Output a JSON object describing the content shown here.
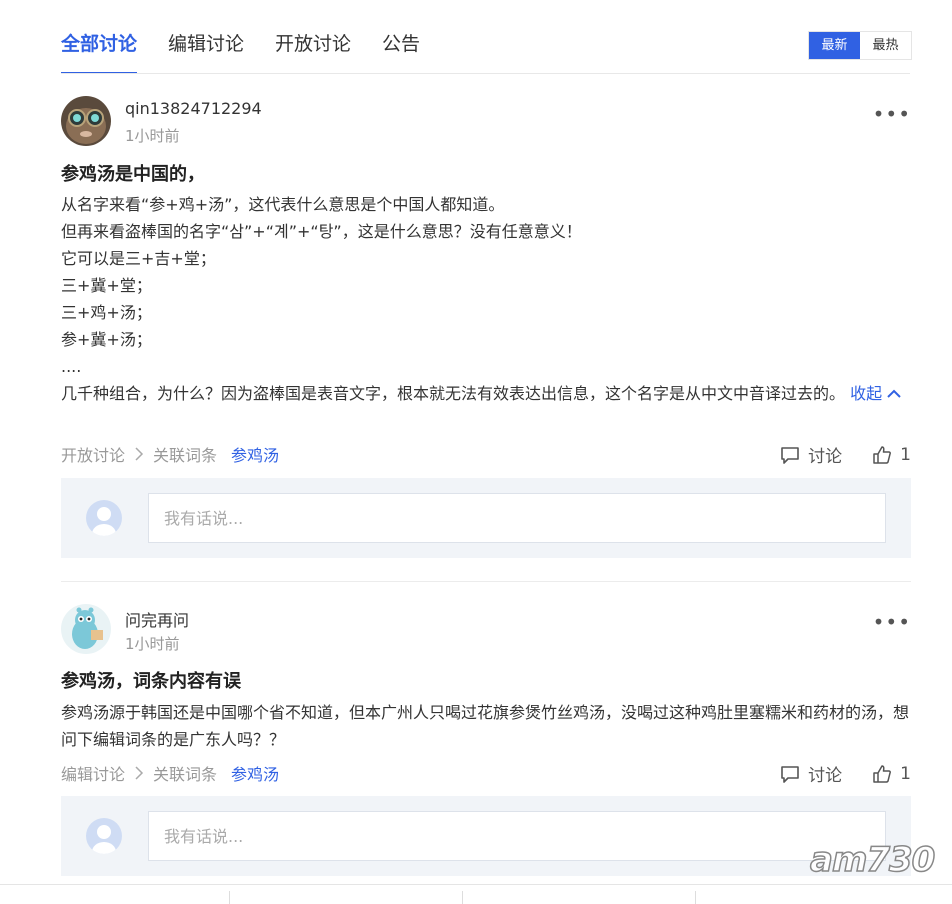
{
  "tabs": [
    {
      "label": "全部讨论",
      "active": true
    },
    {
      "label": "编辑讨论",
      "active": false
    },
    {
      "label": "开放讨论",
      "active": false
    },
    {
      "label": "公告",
      "active": false
    }
  ],
  "sort": {
    "latest": "最新",
    "hot": "最热"
  },
  "posts": [
    {
      "username": "qin13824712294",
      "time": "1小时前",
      "title": "参鸡汤是中国的，",
      "lines": [
        "从名字来看“参+鸡+汤”，这代表什么意思是个中国人都知道。",
        "但再来看盗棒国的名字“삼”+“계”+“탕”，这是什么意思？没有任意意义！",
        "它可以是三+吉+堂；",
        "三+冀+堂；",
        "三+鸡+汤；",
        "参+冀+汤；",
        "....",
        "几千种组合，为什么？因为盗棒国是表音文字，根本就无法有效表达出信息，这个名字是从中文中音译过去的。"
      ],
      "collapse": "收起",
      "category": "开放讨论",
      "related": "关联词条",
      "tag": "参鸡汤",
      "discuss": "讨论",
      "likes": "1",
      "reply_placeholder": "我有话说..."
    },
    {
      "username": "问完再问",
      "time": "1小时前",
      "title": "参鸡汤，词条内容有误",
      "lines": [
        "参鸡汤源于韩国还是中国哪个省不知道，但本广州人只喝过花旗参煲竹丝鸡汤，没喝过这种鸡肚里塞糯米和药材的汤，想问下编辑词条的是广东人吗？？"
      ],
      "category": "编辑讨论",
      "related": "关联词条",
      "tag": "参鸡汤",
      "discuss": "讨论",
      "likes": "1",
      "reply_placeholder": "我有话说..."
    }
  ],
  "watermark": "am730",
  "colors": {
    "accent": "#3061e3",
    "muted": "#999999",
    "reply_bg": "#f1f4f8"
  }
}
